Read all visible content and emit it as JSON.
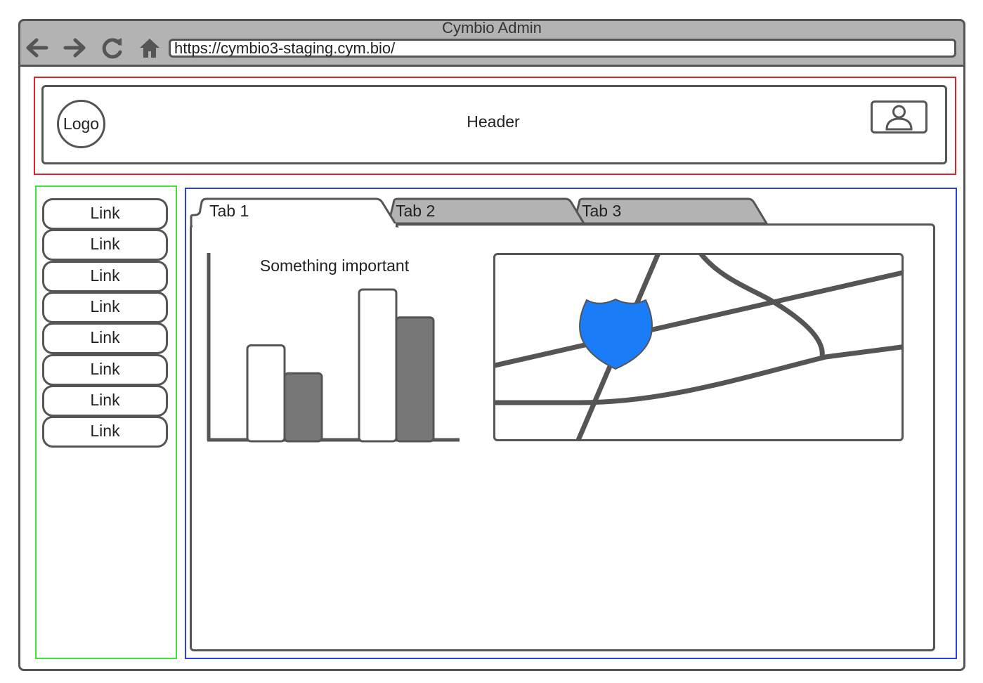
{
  "window": {
    "title": "Cymbio Admin",
    "url": "https://cymbio3-staging.cym.bio/"
  },
  "toolbar": {
    "icons": [
      "back-arrow-icon",
      "forward-arrow-icon",
      "reload-icon",
      "home-icon"
    ]
  },
  "header": {
    "logo_label": "Logo",
    "title": "Header",
    "avatar_icon": "user-icon"
  },
  "sidebar": {
    "items": [
      {
        "label": "Link"
      },
      {
        "label": "Link"
      },
      {
        "label": "Link"
      },
      {
        "label": "Link"
      },
      {
        "label": "Link"
      },
      {
        "label": "Link"
      },
      {
        "label": "Link"
      },
      {
        "label": "Link"
      }
    ]
  },
  "tabs": [
    {
      "label": "Tab 1",
      "active": true
    },
    {
      "label": "Tab 2",
      "active": false
    },
    {
      "label": "Tab 3",
      "active": false
    }
  ],
  "main": {
    "chart_title": "Something important",
    "map_marker_icon": "shield-marker-icon"
  },
  "chart_data": {
    "type": "bar",
    "title": "Something important",
    "xlabel": "",
    "ylabel": "",
    "categories": [
      "",
      ""
    ],
    "series": [
      {
        "values": [
          50,
          80
        ],
        "color": "#ffffff"
      },
      {
        "values": [
          35,
          65
        ],
        "color": "#777777"
      }
    ],
    "ylim": [
      0,
      100
    ],
    "grid": false
  },
  "colors": {
    "frame": "#555555",
    "browser_bar": "#b3b3b3",
    "inactive_tab": "#b3b3b3",
    "header_outline": "#e0212a",
    "sidebar_outline": "#3ee23a",
    "content_outline": "#2b3ee0",
    "map_marker": "#1a7cf6"
  }
}
